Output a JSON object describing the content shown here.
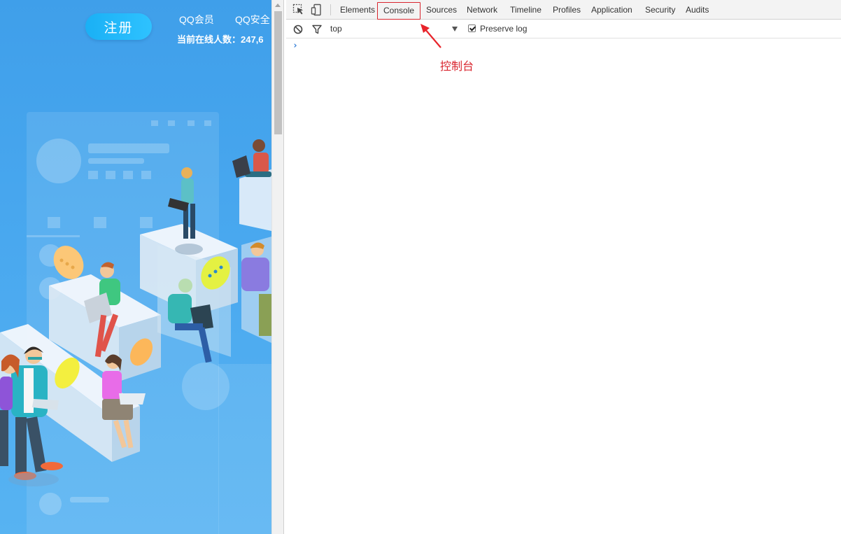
{
  "webpage": {
    "register_button": "注册",
    "links": [
      "QQ会员",
      "QQ安全"
    ],
    "online_text": "当前在线人数：247,6"
  },
  "devtools": {
    "tabs": [
      {
        "label": "Elements"
      },
      {
        "label": "Console",
        "active": true
      },
      {
        "label": "Sources"
      },
      {
        "label": "Network"
      },
      {
        "label": "Timeline"
      },
      {
        "label": "Profiles"
      },
      {
        "label": "Application"
      },
      {
        "label": "Security"
      },
      {
        "label": "Audits"
      }
    ],
    "toolbar_icons": [
      "inspect-element-icon",
      "device-mode-icon"
    ],
    "console": {
      "clear_icon": "clear-console-icon",
      "filter_icon": "filter-icon",
      "context": "top",
      "preserve_log_label": "Preserve log",
      "preserve_log_checked": true,
      "prompt": "›"
    }
  },
  "annotation": {
    "label": "控制台",
    "color": "#d9252e"
  },
  "colors": {
    "page_bg": "#47a6ee",
    "register_button": "#21b8fa",
    "highlight": "#d9252e",
    "prompt": "#2f7cd6"
  }
}
